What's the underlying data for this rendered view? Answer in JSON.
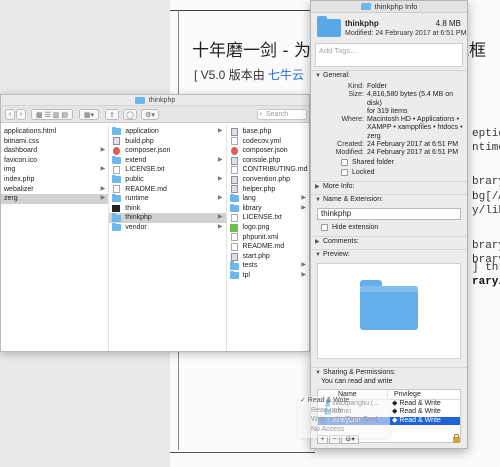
{
  "background_doc": {
    "title": "十年磨一剑 - 为",
    "title_right": "能框",
    "subtitle_prefix": "[ V5.0 版本由 ",
    "subtitle_link": "七牛云",
    "code_lines": [
      "eption'",
      "ntime/",
      "brary/th",
      "bg[/Ap",
      "y/librar",
      "brary/th",
      "brary/th",
      "] throw",
      "rary/t"
    ]
  },
  "finder": {
    "title": "thinkphp",
    "search_placeholder": "Search",
    "col1": [
      "applications.html",
      "bitnami.css",
      "dashboard",
      "favicon.ico",
      "img",
      "index.php",
      "webalizer",
      "zerg"
    ],
    "col2": [
      {
        "name": "application",
        "icon": "folder"
      },
      {
        "name": "build.php",
        "icon": "php"
      },
      {
        "name": "composer.json",
        "icon": "json"
      },
      {
        "name": "extend",
        "icon": "folder"
      },
      {
        "name": "LICENSE.txt",
        "icon": "file"
      },
      {
        "name": "public",
        "icon": "folder"
      },
      {
        "name": "README.md",
        "icon": "file"
      },
      {
        "name": "runtime",
        "icon": "folder"
      },
      {
        "name": "think",
        "icon": "term"
      },
      {
        "name": "thinkphp",
        "icon": "folder"
      },
      {
        "name": "vendor",
        "icon": "folder"
      }
    ],
    "col3": [
      {
        "name": "base.php",
        "icon": "php"
      },
      {
        "name": "codecov.yml",
        "icon": "file"
      },
      {
        "name": "composer.json",
        "icon": "json"
      },
      {
        "name": "console.php",
        "icon": "php"
      },
      {
        "name": "CONTRIBUTING.md",
        "icon": "file"
      },
      {
        "name": "convention.php",
        "icon": "php"
      },
      {
        "name": "helper.php",
        "icon": "php"
      },
      {
        "name": "lang",
        "icon": "folder"
      },
      {
        "name": "library",
        "icon": "folder"
      },
      {
        "name": "LICENSE.txt",
        "icon": "file"
      },
      {
        "name": "logo.png",
        "icon": "img"
      },
      {
        "name": "phpunit.xml",
        "icon": "file"
      },
      {
        "name": "README.md",
        "icon": "file"
      },
      {
        "name": "start.php",
        "icon": "php"
      },
      {
        "name": "tests",
        "icon": "folder"
      },
      {
        "name": "tpl",
        "icon": "folder"
      }
    ]
  },
  "info": {
    "window_title": "thinkphp Info",
    "name": "thinkphp",
    "size": "4.8 MB",
    "modified_line": "Modified: 24 February 2017 at 6:51 PM",
    "tags_placeholder": "Add Tags...",
    "general_label": "General:",
    "kind_k": "Kind:",
    "kind_v": "Folder",
    "size_k": "Size:",
    "size_v": "4,816,580 bytes (5.4 MB on disk)",
    "items_v": "for 319 items",
    "where_k": "Where:",
    "where_v1": "Macintosh HD • Applications •",
    "where_v2": "XAMPP • xamppfiles • htdocs •",
    "where_v3": "zerg",
    "created_k": "Created:",
    "created_v": "24 February 2017 at 6:51 PM",
    "modified_k": "Modified:",
    "modified_v": "24 February 2017 at 6:51 PM",
    "shared_folder": "Shared folder",
    "locked": "Locked",
    "more_info": "More Info:",
    "name_ext": "Name & Extension:",
    "name_field_value": "thinkphp",
    "hide_extension": "Hide extension",
    "comments": "Comments:",
    "preview": "Preview:",
    "sharing": "Sharing & Permissions:",
    "can_rw": "You can read and write",
    "col_name": "Name",
    "col_priv": "Privilege",
    "rows": [
      {
        "name": "xiaoqiangliu (...",
        "priv": "◆ Read & Write",
        "sel": false
      },
      {
        "name": "admin",
        "priv": "◆ Read & Write",
        "sel": false
      },
      {
        "name": "everyone",
        "priv": "◆ Read & Write",
        "sel": true
      }
    ],
    "btn_add": "+",
    "btn_remove": "−",
    "btn_gear": "⚙▾"
  },
  "popup": {
    "items": [
      "✓ Read & Write",
      "Read only",
      "Write only (Drop Box)",
      "No Access"
    ]
  }
}
